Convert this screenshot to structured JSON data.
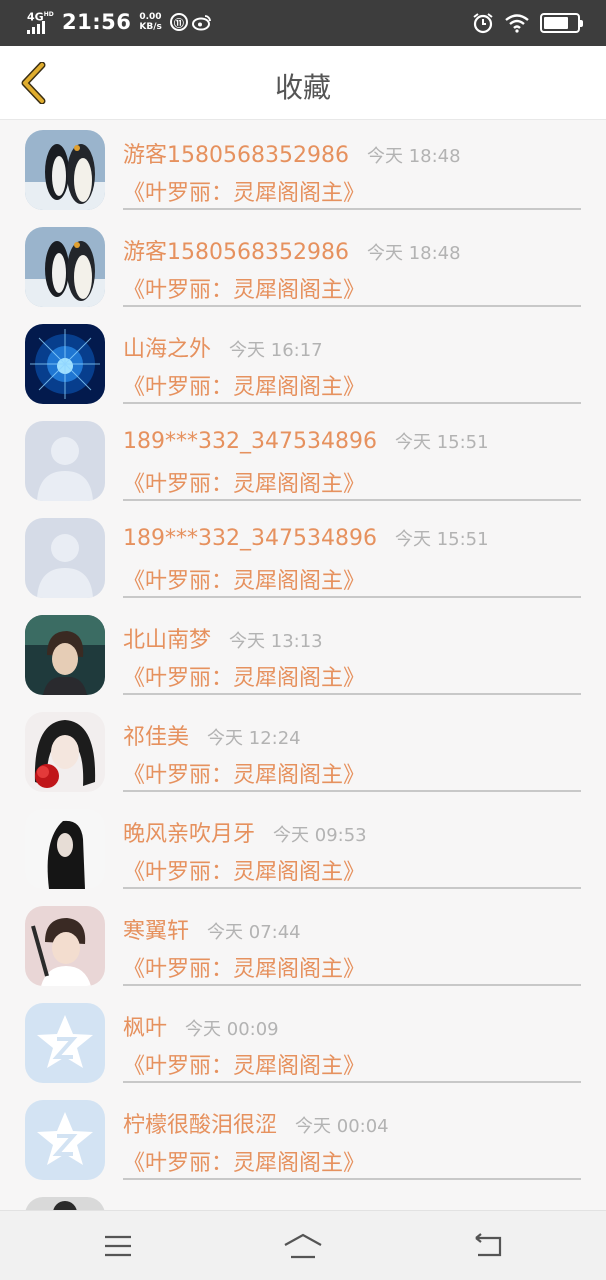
{
  "status_bar": {
    "network": "4G",
    "network_sup": "HD",
    "time": "21:56",
    "speed_value": "0.00",
    "speed_unit": "KB/s",
    "circle_icon_text": "⑪",
    "icons": [
      "signal-icon",
      "weibo-icon",
      "alarm-icon",
      "wifi-icon",
      "battery-icon"
    ],
    "battery_level_fraction": 0.75
  },
  "header": {
    "title": "收藏",
    "back_icon": "chevron-left-icon",
    "accent_color": "#d9a62b"
  },
  "items": [
    {
      "name": "游客1580568352986",
      "time": "今天 18:48",
      "book": "《叶罗丽：灵犀阁阁主》",
      "avatar": "penguin-avatar"
    },
    {
      "name": "游客1580568352986",
      "time": "今天 18:48",
      "book": "《叶罗丽：灵犀阁阁主》",
      "avatar": "penguin-avatar"
    },
    {
      "name": "山海之外",
      "time": "今天 16:17",
      "book": "《叶罗丽：灵犀阁阁主》",
      "avatar": "blue-sparkle-avatar"
    },
    {
      "name": "189***332_347534896",
      "time": "今天 15:51",
      "book": "《叶罗丽：灵犀阁阁主》",
      "avatar": "default-person-avatar"
    },
    {
      "name": "189***332_347534896",
      "time": "今天 15:51",
      "book": "《叶罗丽：灵犀阁阁主》",
      "avatar": "default-person-avatar"
    },
    {
      "name": "北山南梦",
      "time": "今天 13:13",
      "book": "《叶罗丽：灵犀阁阁主》",
      "avatar": "anime-boy-dark-avatar"
    },
    {
      "name": "祁佳美",
      "time": "今天 12:24",
      "book": "《叶罗丽：灵犀阁阁主》",
      "avatar": "anime-girl-flower-avatar"
    },
    {
      "name": "晚风亲吹月牙",
      "time": "今天 09:53",
      "book": "《叶罗丽：灵犀阁阁主》",
      "avatar": "black-hair-girl-avatar"
    },
    {
      "name": "寒翼轩",
      "time": "今天 07:44",
      "book": "《叶罗丽：灵犀阁阁主》",
      "avatar": "anime-boy-pink-avatar"
    },
    {
      "name": "枫叶",
      "time": "今天 00:09",
      "book": "《叶罗丽：灵犀阁阁主》",
      "avatar": "qq-star-avatar"
    },
    {
      "name": "柠檬很酸泪很涩",
      "time": "今天 00:04",
      "book": "《叶罗丽：灵犀阁阁主》",
      "avatar": "qq-star-avatar"
    },
    {
      "name": "",
      "time": "",
      "book": "",
      "avatar": "partial-avatar"
    }
  ],
  "nav_bar": {
    "buttons": [
      "menu-icon",
      "home-icon",
      "back-nav-icon"
    ]
  },
  "colors": {
    "name_color": "#e6915e",
    "time_color": "#b3b3b3",
    "status_bar_bg": "#3d3d3d",
    "page_bg": "#f7f6f6"
  }
}
